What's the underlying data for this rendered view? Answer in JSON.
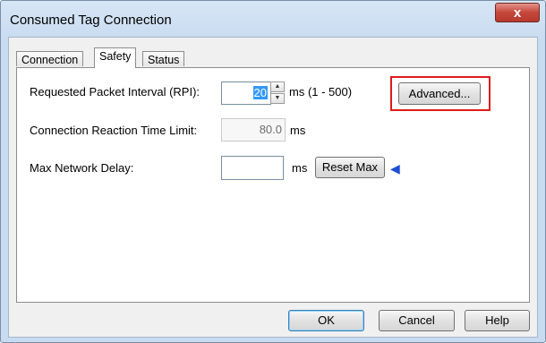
{
  "window": {
    "title": "Consumed Tag Connection",
    "close_glyph": "x"
  },
  "tabs": [
    {
      "label": "Connection",
      "active": false
    },
    {
      "label": "Safety",
      "active": true
    },
    {
      "label": "Status",
      "active": false
    }
  ],
  "safety": {
    "rpi": {
      "label": "Requested Packet Interval (RPI):",
      "value": "20",
      "unit_range": "ms  (1 - 500)",
      "spin_up": "▲",
      "spin_down": "▼"
    },
    "advanced_label": "Advanced...",
    "reaction": {
      "label": "Connection Reaction Time Limit:",
      "value": "80.0",
      "unit": "ms"
    },
    "max_delay": {
      "label": "Max Network Delay:",
      "value": "",
      "unit": "ms",
      "reset_label": "Reset Max",
      "arrow_glyph": "◀"
    }
  },
  "footer": {
    "ok_label": "OK",
    "cancel_label": "Cancel",
    "help_label": "Help"
  },
  "colors": {
    "highlight": "#e01a1a",
    "arrow": "#1f4ed6",
    "selection": "#3399ff"
  }
}
